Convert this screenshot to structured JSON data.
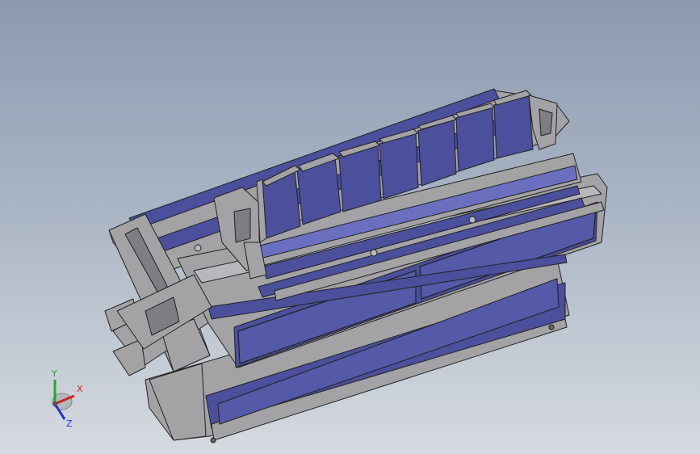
{
  "viewport": {
    "background_top": "#8c9ab0",
    "background_bottom": "#d6dae0"
  },
  "model": {
    "face_color": "#4b4f9c",
    "face_light": "#6a6fc0",
    "frame_color": "#a3a3a6",
    "frame_dark": "#7d7d82",
    "edge_color": "#222222"
  },
  "triad": {
    "x_label": "X",
    "y_label": "Y",
    "z_label": "Z",
    "x_color": "#cc2222",
    "y_color": "#22aa22",
    "z_color": "#2233cc",
    "icon": "view-orientation-triad-icon"
  }
}
